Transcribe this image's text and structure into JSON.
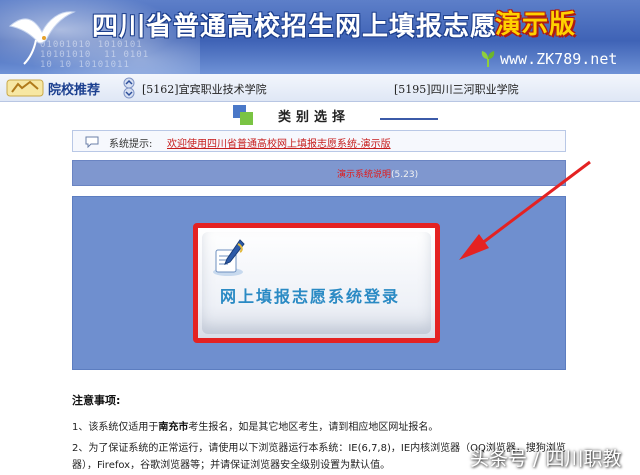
{
  "header": {
    "title": "四川省普通高校招生网上填报志愿",
    "badge": "演示版",
    "site": "www.ZK789.net",
    "binary_text": "01001010 1010101\n10101010  11 0101\n10 10 10101011"
  },
  "recommend": {
    "label": "院校推荐",
    "school_1": "[5162]宜宾职业技术学院",
    "school_2": "[5195]四川三河职业学院"
  },
  "category": {
    "title": "类别选择"
  },
  "notice": {
    "label": "系统提示:",
    "text": "欢迎使用四川省普通高校网上填报志愿系统-演示版"
  },
  "version": {
    "label": "演示系统说明",
    "number": "(5.23)"
  },
  "login": {
    "label": "网上填报志愿系统登录"
  },
  "notes": {
    "title": "注意事项:",
    "item_1_prefix": "1、该系统仅适用于",
    "item_1_city": "南充市",
    "item_1_suffix": "考生报名，如是其它地区考生，请到相应地区网址报名。",
    "item_2": "2、为了保证系统的正常运行，请使用以下浏览器运行本系统：IE(6,7,8)，IE内核浏览器（QQ浏览器，搜狗浏览器），Firefox，谷歌浏览器等；并请保证浏览器安全级别设置为默认值。"
  },
  "watermark": "头条号 / 四川职教",
  "colors": {
    "header_blue": "#3f63b6",
    "panel_blue": "#6f8fcf",
    "highlight_red": "#e42222",
    "login_text": "#2a8ac4",
    "badge_yellow": "#ffd200"
  }
}
